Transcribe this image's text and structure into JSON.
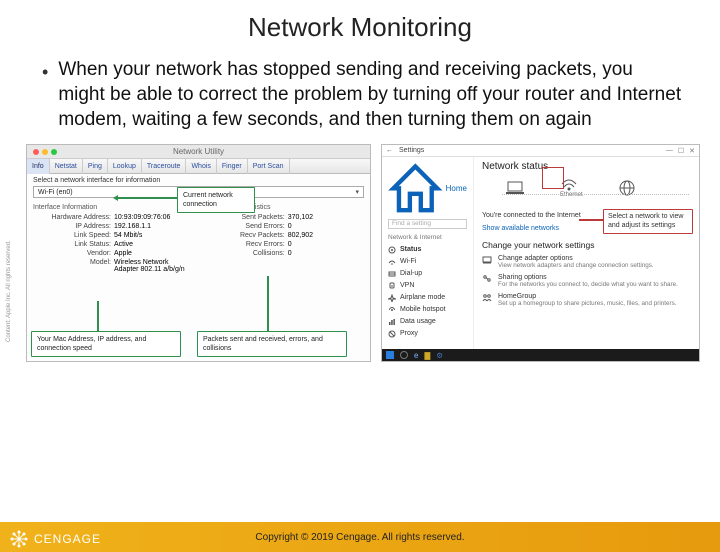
{
  "slide": {
    "title": "Network Monitoring",
    "bullet": "When your network has stopped sending and receiving packets, you might be able to correct the problem by turning off your router and Internet modem, waiting a few seconds, and then turning them on again"
  },
  "mac": {
    "window_title": "Network Utility",
    "tabs": [
      "Info",
      "Netstat",
      "Ping",
      "Lookup",
      "Traceroute",
      "Whois",
      "Finger",
      "Port Scan"
    ],
    "select_label": "Select a network interface for information",
    "dropdown_value": "Wi-Fi (en0)",
    "left_heading": "Interface Information",
    "right_heading": "Transfer Statistics",
    "left_rows": [
      {
        "k": "Hardware Address:",
        "v": "10:93:09:09:76:06"
      },
      {
        "k": "IP Address:",
        "v": "192.168.1.1"
      },
      {
        "k": "Link Speed:",
        "v": "54 Mbit/s"
      },
      {
        "k": "Link Status:",
        "v": "Active"
      },
      {
        "k": "Vendor:",
        "v": "Apple"
      },
      {
        "k": "Model:",
        "v": "Wireless Network\nAdapter 802.11 a/b/g/n"
      }
    ],
    "right_rows": [
      {
        "k": "Sent Packets:",
        "v": "370,102"
      },
      {
        "k": "Send Errors:",
        "v": "0"
      },
      {
        "k": "Recv Packets:",
        "v": "802,902"
      },
      {
        "k": "Recv Errors:",
        "v": "0"
      },
      {
        "k": "Collisions:",
        "v": "0"
      }
    ],
    "callout_top": "Current network\nconnection",
    "callout_bl": "Your Mac Address, IP address,\nand connection speed",
    "callout_br": "Packets sent and received,\nerrors, and collisions"
  },
  "win": {
    "app_title": "Settings",
    "home": "Home",
    "search_placeholder": "Find a setting",
    "category": "Network & Internet",
    "side_items": [
      {
        "icon": "status",
        "label": "Status"
      },
      {
        "icon": "wifi",
        "label": "Wi-Fi"
      },
      {
        "icon": "dialup",
        "label": "Dial-up"
      },
      {
        "icon": "vpn",
        "label": "VPN"
      },
      {
        "icon": "airplane",
        "label": "Airplane mode"
      },
      {
        "icon": "hotspot",
        "label": "Mobile hotspot"
      },
      {
        "icon": "data",
        "label": "Data usage"
      },
      {
        "icon": "proxy",
        "label": "Proxy"
      }
    ],
    "main_heading": "Network status",
    "connected_text": "You're connected to the Internet",
    "troubleshoot_link": "Show available networks",
    "change_heading": "Change your network settings",
    "options": [
      {
        "icon": "adapter",
        "title": "Change adapter options",
        "desc": "View network adapters and change connection settings."
      },
      {
        "icon": "sharing",
        "title": "Sharing options",
        "desc": "For the networks you connect to, decide what you want to share."
      },
      {
        "icon": "homegroup",
        "title": "HomeGroup",
        "desc": "Set up a homegroup to share pictures, music, files, and printers."
      }
    ],
    "callout": "Select a network to\nview and adjust its\nsettings",
    "center_icon_label": "Ethernet"
  },
  "sidecaption": "Content: Apple Inc. All rights reserved.",
  "footer": {
    "copyright": "Copyright © 2019 Cengage. All rights reserved.",
    "brand": "CENGAGE"
  }
}
